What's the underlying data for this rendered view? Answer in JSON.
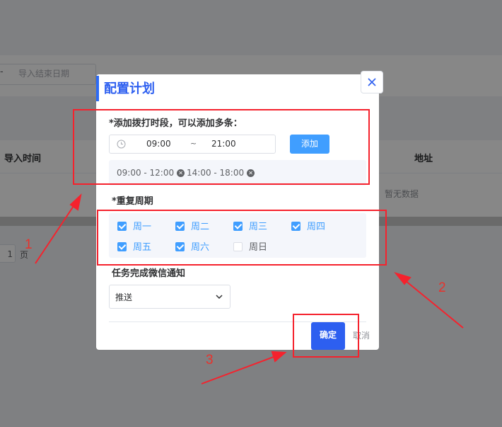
{
  "background": {
    "date_separator": "-",
    "end_date_placeholder": "导入结束日期",
    "table_headers": [
      "导入时间",
      "地址"
    ],
    "empty_text": "暂无数据",
    "page_number": "1",
    "page_suffix": "页"
  },
  "dialog": {
    "title": "配置计划",
    "close_icon": "close-icon",
    "time_label": "*添加拨打时段，可以添加多条：",
    "time_start": "09:00",
    "time_separator": "~",
    "time_end": "21:00",
    "add_button": "添加",
    "slots": [
      "09:00 - 12:00",
      "14:00 - 18:00"
    ],
    "repeat_label": "*重复周期",
    "weekdays": [
      {
        "label": "周一",
        "checked": true
      },
      {
        "label": "周二",
        "checked": true
      },
      {
        "label": "周三",
        "checked": true
      },
      {
        "label": "周四",
        "checked": true
      },
      {
        "label": "周五",
        "checked": true
      },
      {
        "label": "周六",
        "checked": true
      },
      {
        "label": "周日",
        "checked": false
      }
    ],
    "notify_label": "任务完成微信通知",
    "notify_value": "推送",
    "confirm_button": "确定",
    "cancel_button": "取消"
  },
  "annotations": {
    "labels": [
      "1",
      "2",
      "3"
    ],
    "color": "#f5222d"
  },
  "colors": {
    "primary": "#409eff",
    "title": "#2d5ff0",
    "confirm": "#2d5ff0"
  }
}
